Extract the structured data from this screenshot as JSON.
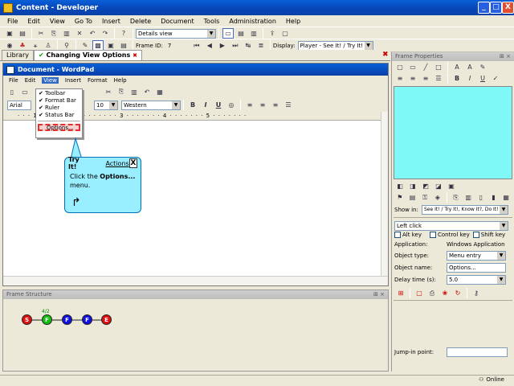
{
  "window": {
    "title": "Content - Developer",
    "minimize": "_",
    "maximize": "□",
    "close": "X"
  },
  "menubar": [
    "File",
    "Edit",
    "View",
    "Go To",
    "Insert",
    "Delete",
    "Document",
    "Tools",
    "Administration",
    "Help"
  ],
  "toolbar": {
    "view_combo": "Details view",
    "frame_id_label": "Frame ID:",
    "frame_id_value": "7",
    "display_label": "Display:",
    "display_value": "Player - See It! / Try It!"
  },
  "tabs": [
    {
      "label": "Library"
    },
    {
      "label": "Changing View Options"
    }
  ],
  "tab_close": "✖",
  "wordpad": {
    "title": "Document - WordPad",
    "menu": [
      "File",
      "Edit",
      "View",
      "Insert",
      "Format",
      "Help"
    ],
    "font": "Arial",
    "size": "10",
    "script": "Western",
    "bold": "B",
    "italic": "I",
    "underline": "U",
    "ruler": "· · · 1 · · · · · · · 2 · · · · · · · 3 · · · · · · · 4 · · · · · · · 5 · · · · · · ·"
  },
  "view_menu": {
    "items": [
      {
        "label": "Toolbar",
        "checked": "✔"
      },
      {
        "label": "Format Bar",
        "checked": "✔"
      },
      {
        "label": "Ruler",
        "checked": "✔"
      },
      {
        "label": "Status Bar",
        "checked": "✔"
      }
    ],
    "options": "Options..."
  },
  "tryit": {
    "title": "Try It!",
    "actions": "Actions",
    "close": "X",
    "text_pre": "Click the ",
    "text_bold": "Options...",
    "text_post": "menu."
  },
  "frame_structure": {
    "title": "Frame Structure",
    "pin": "⊞ ×",
    "nodes": [
      "S",
      "F",
      "F",
      "F",
      "E"
    ],
    "node_colors": [
      "#e01010",
      "#10c010",
      "#1010e0",
      "#1010e0",
      "#e01010"
    ],
    "marker": "4/2"
  },
  "frame_properties": {
    "title": "Frame Properties",
    "pin": "⊞ ×",
    "show_in_label": "Show in:",
    "show_in_value": "See It! / Try It!, Know It?, Do It!",
    "action": "Left click",
    "alt_key": "Alt key",
    "control_key": "Control key",
    "shift_key": "Shift key",
    "application_label": "Application:",
    "application_value": "Windows Application",
    "object_type_label": "Object type:",
    "object_type_value": "Menu entry",
    "object_name_label": "Object name:",
    "object_name_value": "Options...",
    "delay_label": "Delay time (s):",
    "delay_value": "5.0",
    "jump_label": "Jump-in point:"
  },
  "status": {
    "online": "Online"
  }
}
